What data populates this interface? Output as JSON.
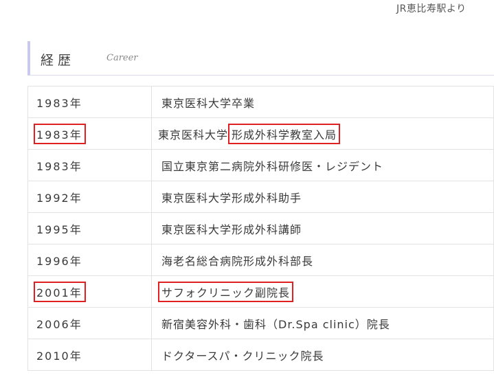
{
  "top_note": "JR恵比寿駅より",
  "heading": {
    "ja": "経歴",
    "en": "Career"
  },
  "career": [
    {
      "year": "1983年",
      "event": "東京医科大学卒業"
    },
    {
      "year": "1983年",
      "event_prefix": "東京医科大学",
      "event_highlight": "形成外科学教室入局"
    },
    {
      "year": "1983年",
      "event": "国立東京第二病院外科研修医・レジデント"
    },
    {
      "year": "1992年",
      "event": "東京医科大学形成外科助手"
    },
    {
      "year": "1995年",
      "event": "東京医科大学形成外科講師"
    },
    {
      "year": "1996年",
      "event": "海老名総合病院形成外科部長"
    },
    {
      "year": "2001年",
      "event_highlight": "サフォクリニック副院長"
    },
    {
      "year": "2006年",
      "event": "新宿美容外科・歯科（Dr.Spa clinic）院長"
    },
    {
      "year": "2010年",
      "event": "ドクタースパ・クリニック院長"
    }
  ],
  "highlight_color": "#e02020"
}
